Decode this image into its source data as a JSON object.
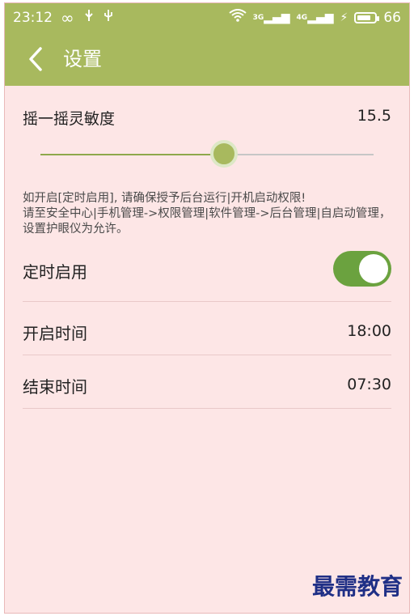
{
  "status_bar": {
    "time": "23:12",
    "icons_left": [
      "infinity-icon",
      "usb-icon",
      "usb-debug-icon"
    ],
    "signal1": "3G",
    "signal2": "4G",
    "battery": "66"
  },
  "app_bar": {
    "title": "设置"
  },
  "settings": {
    "shake_sensitivity": {
      "label": "摇一摇灵敏度",
      "value": "15.5",
      "slider_fraction": 0.55
    },
    "notice": "如开启[定时启用], 请确保授予后台运行|开机启动权限!\n请至安全中心|手机管理->权限管理|软件管理->后台管理|自启动管理，设置护眼仪为允许。",
    "schedule_enable": {
      "label": "定时启用",
      "enabled": true
    },
    "start_time": {
      "label": "开启时间",
      "value": "18:00"
    },
    "end_time": {
      "label": "结束时间",
      "value": "07:30"
    }
  },
  "watermark": "最需教育",
  "colors": {
    "header": "#a8b95e",
    "background": "#fde6e6",
    "switch_on": "#6ba23f"
  }
}
